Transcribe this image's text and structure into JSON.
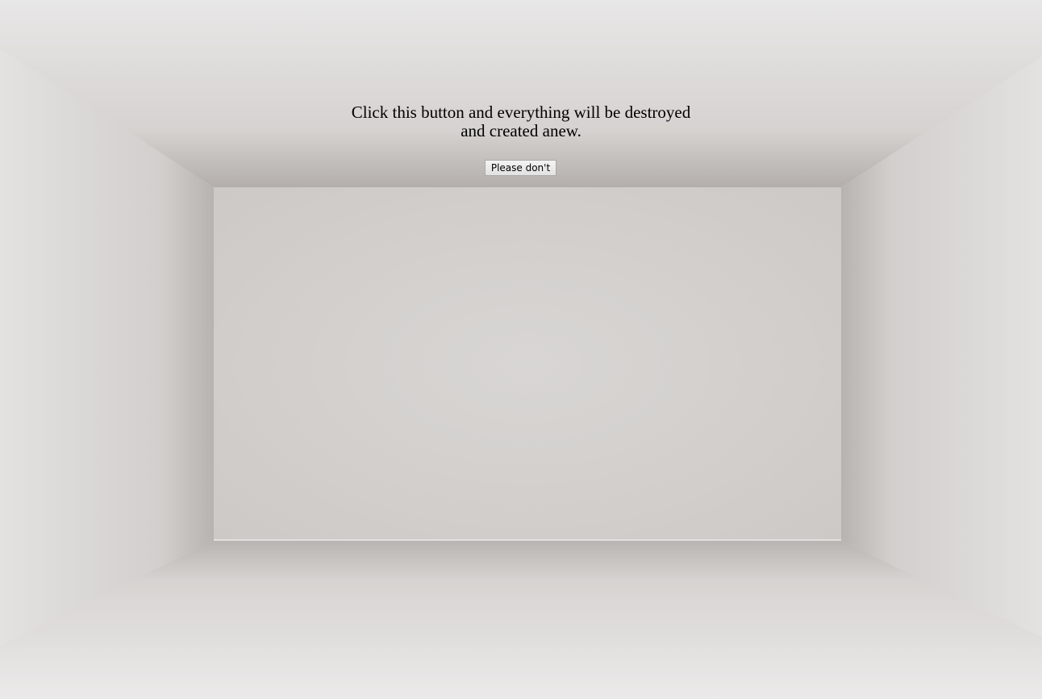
{
  "message": {
    "text": "Click this button and everything will be destroyed and created anew."
  },
  "button": {
    "label": "Please don't"
  },
  "colors": {
    "back_wall": "#d6d3d1",
    "side_wall": "#d8d6d4",
    "ceiling": "#d9d7d6",
    "floor": "#dedcdb",
    "text": "#000000"
  }
}
